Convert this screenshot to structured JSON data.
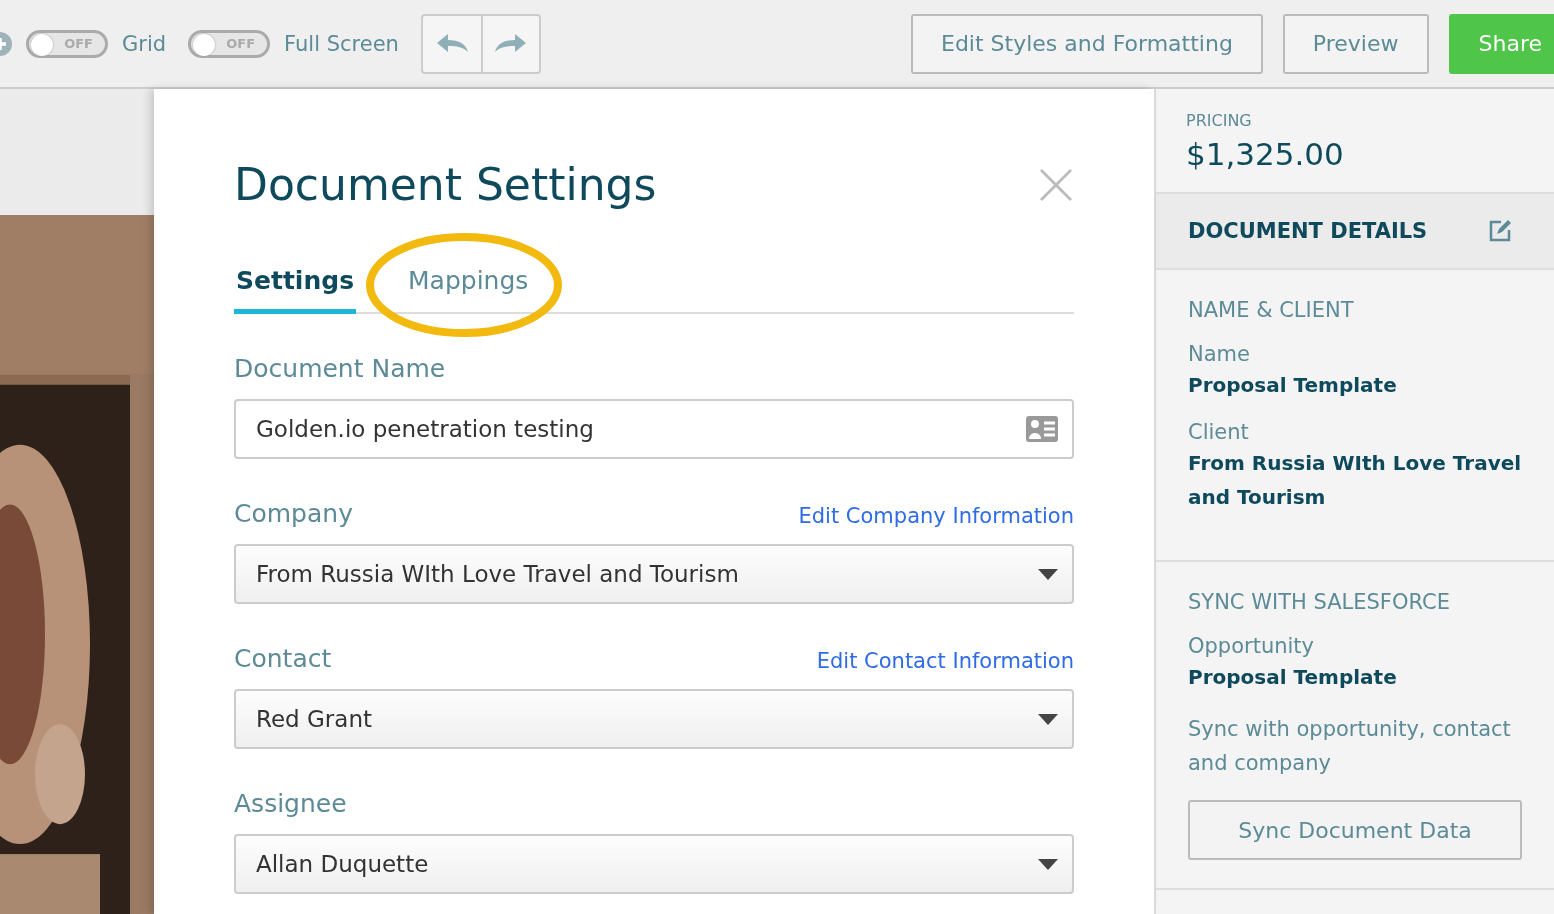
{
  "toolbar": {
    "toggles": [
      {
        "label": "Grid",
        "state_text": "OFF",
        "on": false
      },
      {
        "label": "Full Screen",
        "state_text": "OFF",
        "on": false
      }
    ],
    "buttons": [
      {
        "label": "Edit Styles and Formatting",
        "kind": "outline"
      },
      {
        "label": "Preview",
        "kind": "outline"
      },
      {
        "label": "Share",
        "kind": "primary"
      }
    ]
  },
  "modal": {
    "title": "Document Settings",
    "tabs": [
      {
        "label": "Settings",
        "selected": true,
        "circled": false
      },
      {
        "label": "Mappings",
        "selected": false,
        "circled": true
      }
    ],
    "fields": [
      {
        "label": "Document Name",
        "kind": "text",
        "value": "Golden.io penetration testing"
      },
      {
        "label": "Company",
        "kind": "select",
        "link": "Edit Company Information",
        "value": "From Russia WIth Love Travel and Tourism"
      },
      {
        "label": "Contact",
        "kind": "select",
        "link": "Edit Contact Information",
        "value": "Red Grant"
      },
      {
        "label": "Assignee",
        "kind": "select",
        "value": "Allan Duquette"
      }
    ]
  },
  "sidebar": {
    "pricing_label": "PRICING",
    "pricing_value": "$1,325.00",
    "details_title": "DOCUMENT DETAILS",
    "sections": [
      {
        "title": "NAME & CLIENT",
        "items": [
          {
            "label": "Name",
            "value": "Proposal Template"
          },
          {
            "label": "Client",
            "value": "From Russia WIth Love Travel and Tourism"
          }
        ]
      },
      {
        "title": "SYNC WITH SALESFORCE",
        "items": [
          {
            "label": "Opportunity",
            "value": "Proposal Template"
          }
        ],
        "note": "Sync with opportunity, contact and company",
        "button": "Sync Document Data"
      }
    ]
  }
}
